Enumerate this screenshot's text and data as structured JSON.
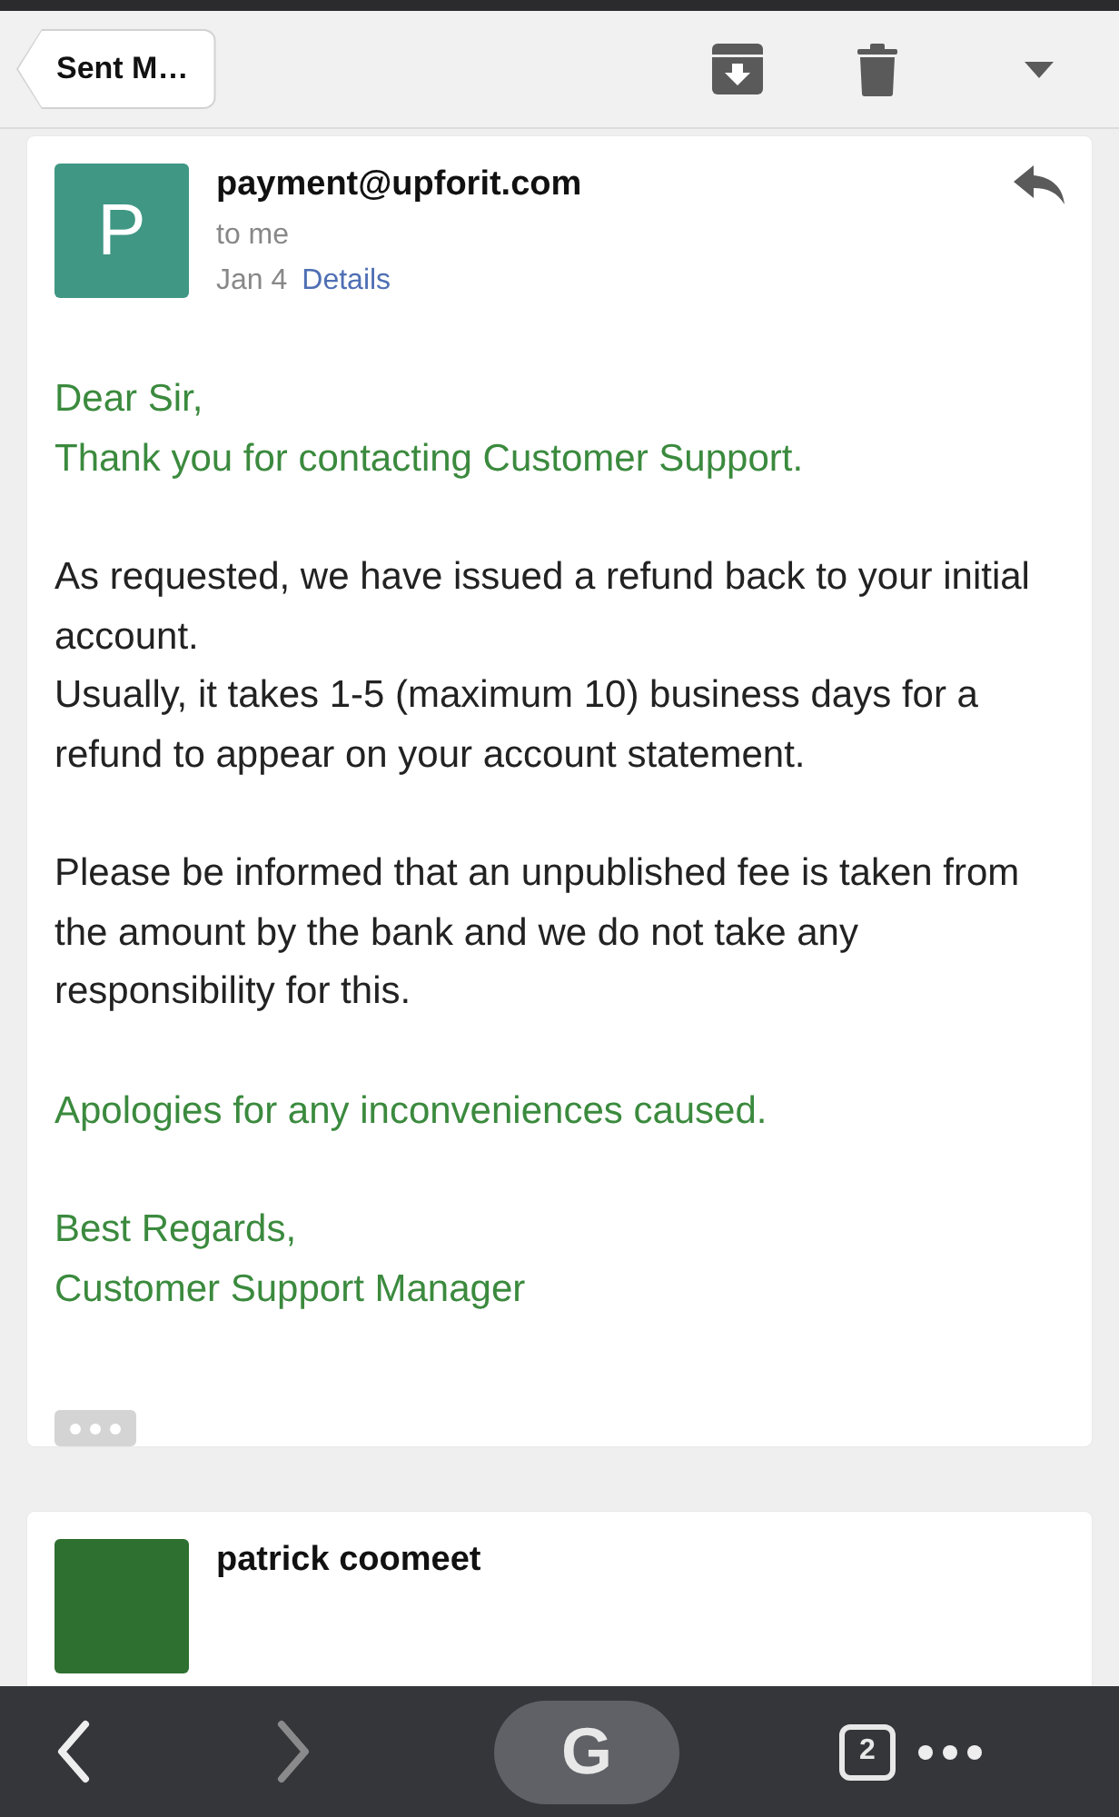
{
  "header": {
    "back_label": "Sent M…"
  },
  "messages": [
    {
      "avatar_letter": "P",
      "color": "#3f9784",
      "sender": "payment@upforit.com",
      "recipient": "to me",
      "date": "Jan 4",
      "details_link": "Details",
      "paragraphs": [
        {
          "kind": "highlight",
          "lines": [
            "Dear Sir,",
            "Thank you for contacting Customer Support."
          ]
        },
        {
          "kind": "plain",
          "lines": [
            "As requested, we have issued a refund back to your initial account.",
            "Usually, it takes 1-5 (maximum 10) business days for a refund to appear on your account statement."
          ]
        },
        {
          "kind": "plain",
          "lines": [
            "Please be informed that an unpublished fee is taken from the amount by the bank and we do not take any responsibility for this."
          ]
        },
        {
          "kind": "highlight",
          "lines": [
            "Apologies for any inconveniences caused."
          ]
        },
        {
          "kind": "highlight",
          "lines": [
            "Best Regards,",
            "Customer Support Manager"
          ]
        }
      ]
    },
    {
      "color": "#2e7030",
      "sender": "patrick coomeet"
    }
  ],
  "browser_bar": {
    "search_label": "G",
    "tab_count": "2"
  }
}
